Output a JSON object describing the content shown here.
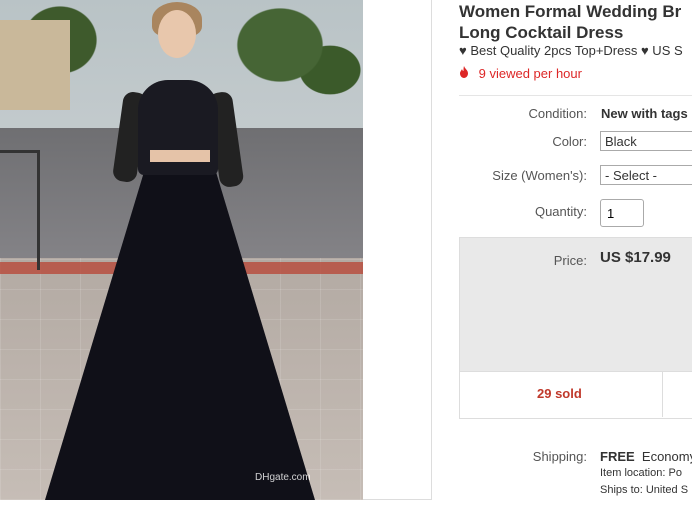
{
  "product": {
    "title_line1": "Women Formal Wedding Br",
    "title_line2": "Long Cocktail Dress",
    "subtitle": "♥ Best Quality 2pcs Top+Dress ♥ US S",
    "views": "9 viewed per hour",
    "image_watermark": "DHgate.com"
  },
  "fields": {
    "condition_label": "Condition:",
    "condition_value": "New with tags",
    "color_label": "Color:",
    "color_value": "Black",
    "size_label": "Size (Women's):",
    "size_value": "- Select -",
    "quantity_label": "Quantity:",
    "quantity_value": "1"
  },
  "price": {
    "label": "Price:",
    "value": "US $17.99",
    "sold": "29 sold"
  },
  "shipping": {
    "label": "Shipping:",
    "free": "FREE",
    "method": "Economy",
    "item_location": "Item location:  Po",
    "ships_to": "Ships to:  United S"
  },
  "colors": {
    "views_red": "#dd2727",
    "sold_red": "#c0392b",
    "price_box": "#e9e9e9"
  }
}
